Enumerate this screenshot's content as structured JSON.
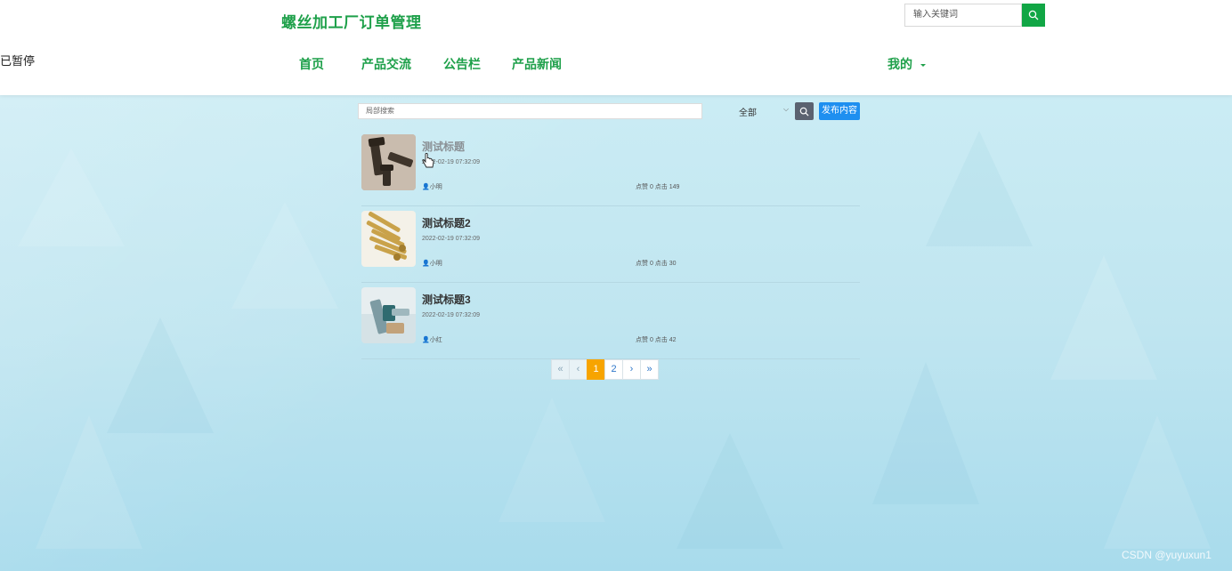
{
  "header": {
    "site_title": "螺丝加工厂订单管理",
    "paused_text": "已暂停",
    "search_placeholder": "输入关键词",
    "nav": [
      "首页",
      "产品交流",
      "公告栏",
      "产品新闻"
    ],
    "mine_label": "我的"
  },
  "toolbar": {
    "local_search_placeholder": "局部搜索",
    "category_selected": "全部",
    "publish_label": "发布内容"
  },
  "posts": [
    {
      "title": "测试标题",
      "date": "2022-02-19 07:32:09",
      "author": "小明",
      "stats": "点赞 0 点击 149"
    },
    {
      "title": "测试标题2",
      "date": "2022-02-19 07:32:09",
      "author": "小明",
      "stats": "点赞 0 点击 30"
    },
    {
      "title": "测试标题3",
      "date": "2022-02-19 07:32:09",
      "author": "小红",
      "stats": "点赞 0 点击 42"
    }
  ],
  "pagination": {
    "first": "«",
    "prev": "‹",
    "pages": [
      "1",
      "2"
    ],
    "next": "›",
    "last": "»",
    "current": "1"
  },
  "watermark": "CSDN @yuyuxun1",
  "colors": {
    "brand_green": "#1ea04a",
    "active_page": "#f7a400",
    "publish_blue": "#1e8ff0"
  }
}
